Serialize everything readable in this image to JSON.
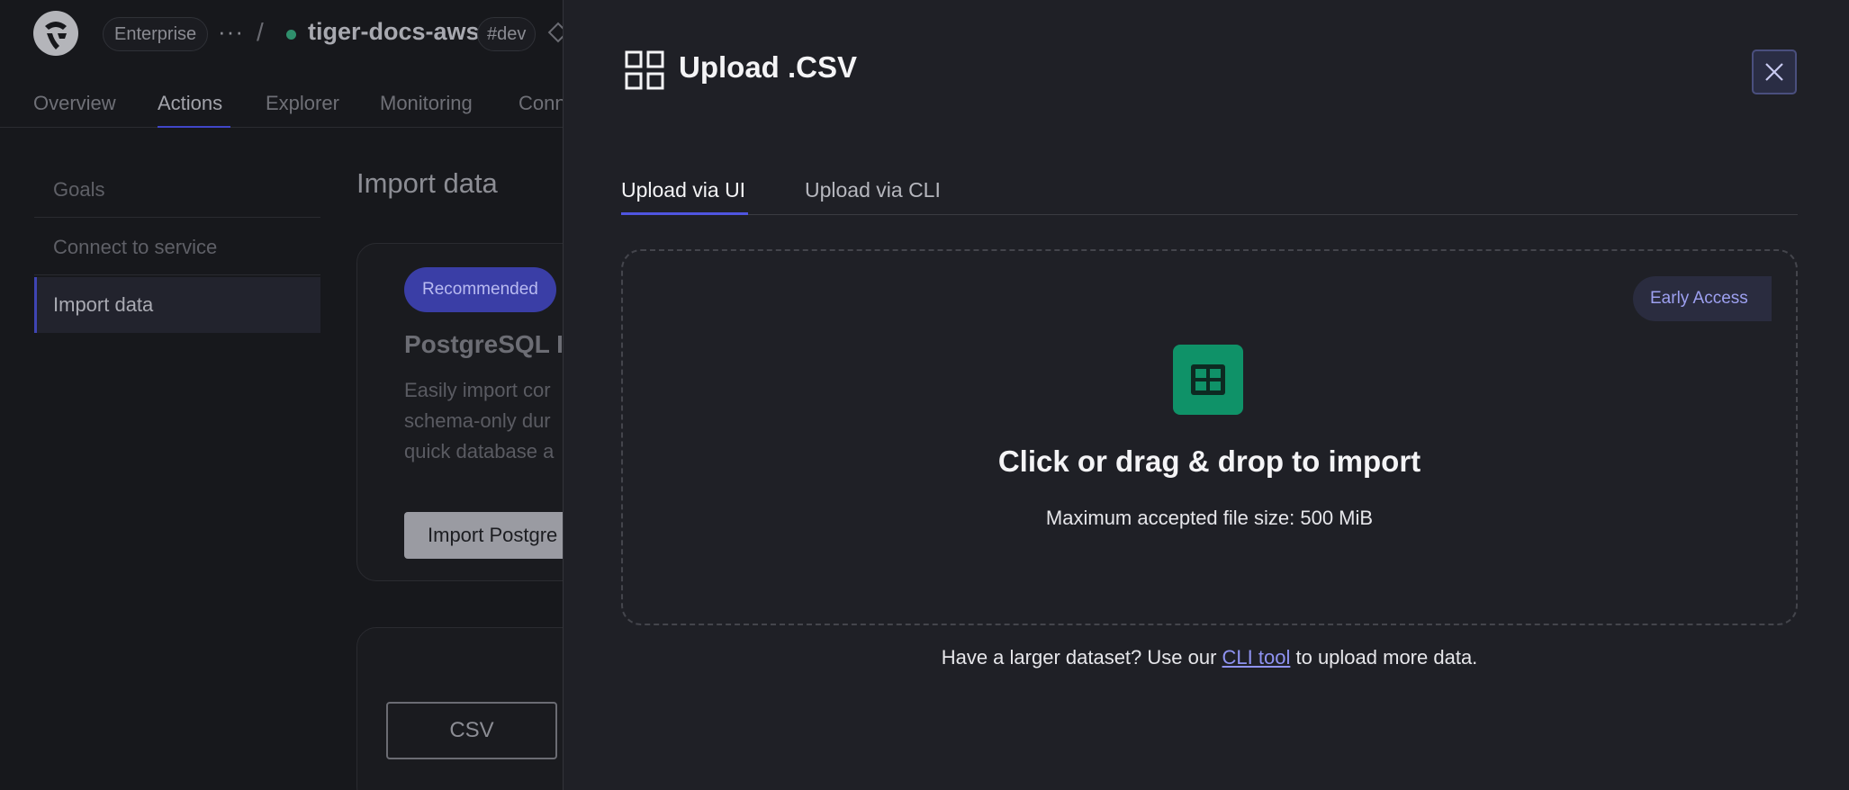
{
  "header": {
    "org_label": "Enterprise",
    "more_label": "···",
    "separator": "/",
    "service_name": "tiger-docs-aws",
    "env_tag": "#dev"
  },
  "nav": {
    "items": [
      "Overview",
      "Actions",
      "Explorer",
      "Monitoring",
      "Conn"
    ],
    "active": "Actions"
  },
  "sidebar": {
    "items": [
      {
        "label": "Goals"
      },
      {
        "label": "Connect to service"
      },
      {
        "label": "Import data"
      }
    ],
    "active": "Import data"
  },
  "main": {
    "title": "Import data",
    "card": {
      "badge": "Recommended",
      "title": "PostgreSQL I",
      "desc_lines": [
        "Easily import cor",
        "schema-only dur",
        "quick database a"
      ],
      "button": "Import Postgre"
    },
    "card2": {
      "button": "CSV"
    }
  },
  "modal": {
    "title": "Upload .CSV",
    "tabs": [
      {
        "label": "Upload via UI"
      },
      {
        "label": "Upload via CLI"
      }
    ],
    "active_tab": "Upload via UI",
    "dropzone": {
      "badge": "Early Access",
      "title": "Click or drag & drop to import",
      "subtitle": "Maximum accepted file size: 500 MiB"
    },
    "footer": {
      "before": "Have a larger dataset? Use our ",
      "link": "CLI tool",
      "after": " to upload more data."
    }
  },
  "colors": {
    "accent": "#4f55e0",
    "dropzone_icon": "#0f9268",
    "badge_bg": "#3a3ea6",
    "link": "#8f93f2"
  },
  "icons": {
    "logo": "tiger-logo-icon",
    "panel": "grid-icon",
    "close": "close-icon",
    "dropzone": "table-icon"
  }
}
